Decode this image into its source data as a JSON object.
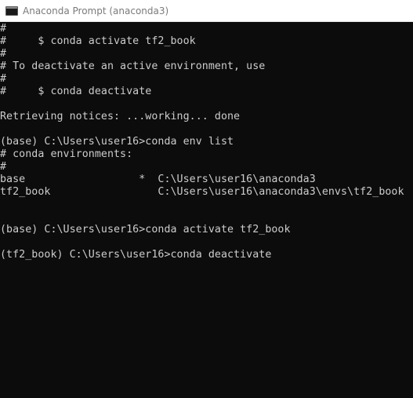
{
  "window": {
    "title": "Anaconda Prompt (anaconda3)",
    "icon": "terminal-icon"
  },
  "console": {
    "lines": [
      "#",
      "#     $ conda activate tf2_book",
      "#",
      "# To deactivate an active environment, use",
      "#",
      "#     $ conda deactivate",
      "",
      "Retrieving notices: ...working... done",
      "",
      "(base) C:\\Users\\user16>conda env list",
      "# conda environments:",
      "#",
      "base                  *  C:\\Users\\user16\\anaconda3",
      "tf2_book                 C:\\Users\\user16\\anaconda3\\envs\\tf2_book",
      "",
      "",
      "(base) C:\\Users\\user16>conda activate tf2_book",
      "",
      "(tf2_book) C:\\Users\\user16>conda deactivate"
    ]
  },
  "colors": {
    "console_background": "#0c0c0c",
    "console_text": "#cccccc",
    "titlebar_background": "#ffffff"
  }
}
